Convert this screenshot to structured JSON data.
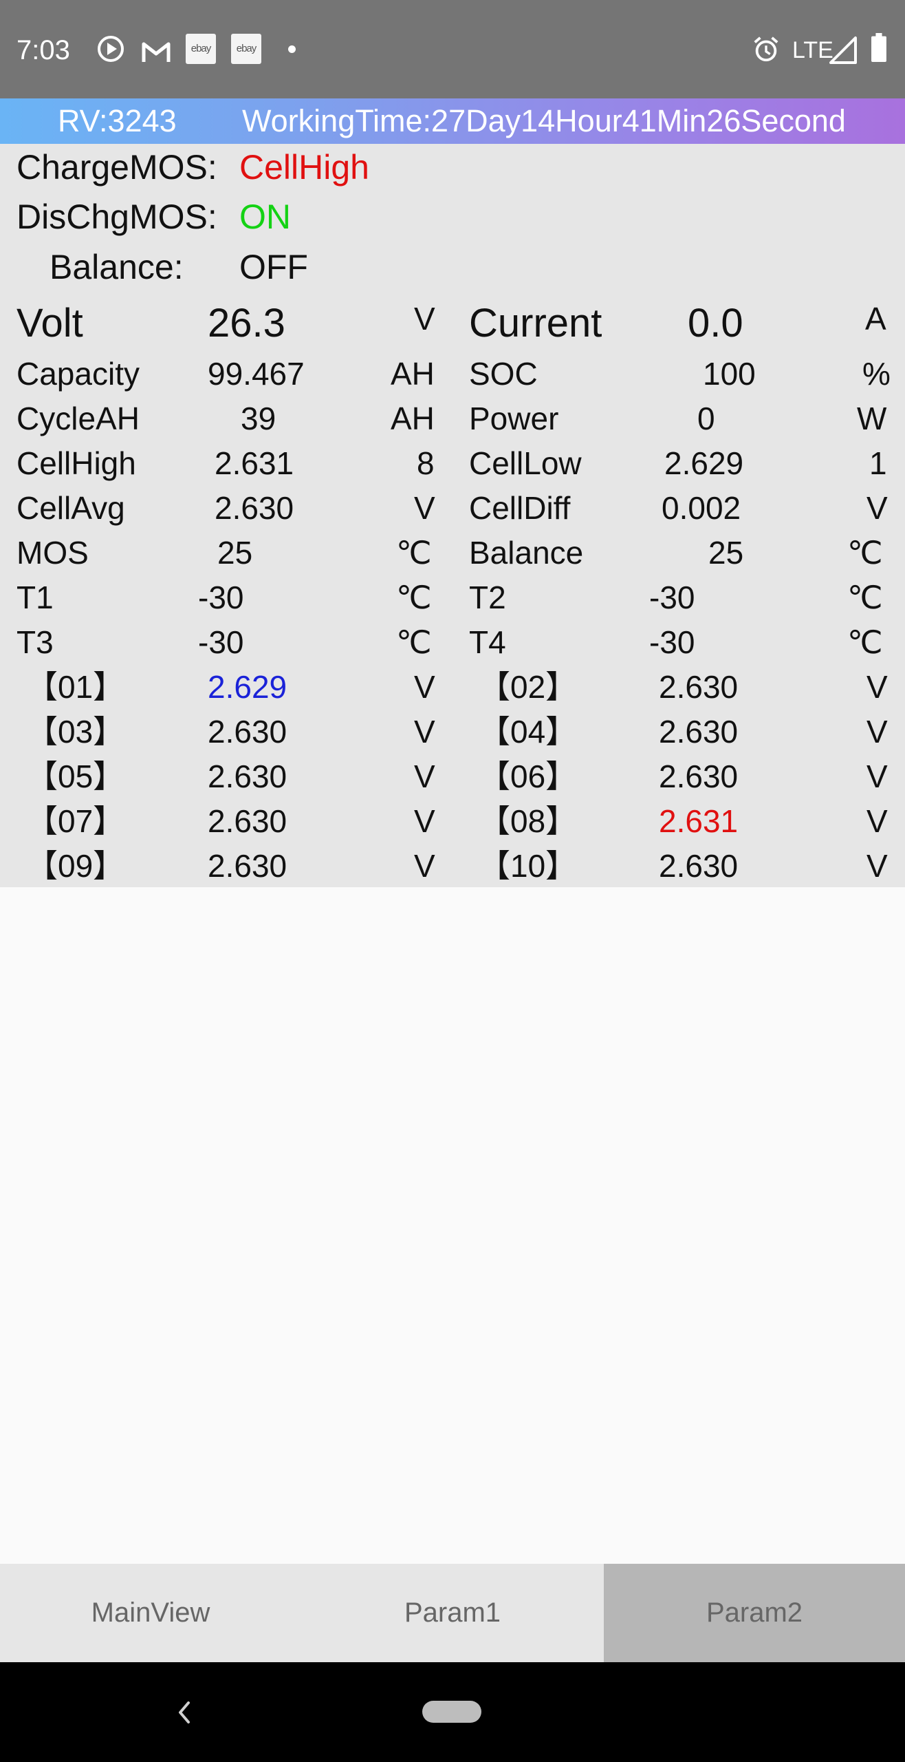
{
  "status_bar": {
    "time": "7:03",
    "icons": [
      "play-circle-icon",
      "gmail-icon",
      "ebay-icon",
      "ebay-icon",
      "dot-icon",
      "alarm-icon",
      "signal-icon",
      "battery-icon"
    ],
    "ebay_label": "ebay",
    "network": "LTE"
  },
  "header": {
    "rv": "RV:3243",
    "working_time": "WorkingTime:27Day14Hour41Min26Second",
    "gradient": [
      "#6ab4f5",
      "#a871de"
    ]
  },
  "state": {
    "charge_label": "ChargeMOS:",
    "charge_value": "CellHigh",
    "dischg_label": "DisChgMOS:",
    "dischg_value": "ON",
    "balance_label": "Balance:",
    "balance_value": "OFF"
  },
  "metrics_left": [
    {
      "label": "Volt",
      "value": "26.3",
      "unit": "V"
    },
    {
      "label": "Capacity",
      "value": "99.467",
      "unit": "AH"
    },
    {
      "label": "CycleAH",
      "value": "39",
      "unit": "AH"
    },
    {
      "label": "CellHigh",
      "value": "2.631",
      "unit": "8"
    },
    {
      "label": "CellAvg",
      "value": "2.630",
      "unit": "V"
    },
    {
      "label": "MOS",
      "value": "25",
      "unit": "℃"
    },
    {
      "label": "T1",
      "value": "-30",
      "unit": "℃"
    },
    {
      "label": "T3",
      "value": "-30",
      "unit": "℃"
    }
  ],
  "metrics_right": [
    {
      "label": "Current",
      "value": "0.0",
      "unit": "A"
    },
    {
      "label": "SOC",
      "value": "100",
      "unit": "%"
    },
    {
      "label": "Power",
      "value": "0",
      "unit": "W"
    },
    {
      "label": "CellLow",
      "value": "2.629",
      "unit": "1"
    },
    {
      "label": "CellDiff",
      "value": "0.002",
      "unit": "V"
    },
    {
      "label": "Balance",
      "value": "25",
      "unit": "℃"
    },
    {
      "label": "T2",
      "value": "-30",
      "unit": "℃"
    },
    {
      "label": "T4",
      "value": "-30",
      "unit": "℃"
    }
  ],
  "cells": [
    {
      "label": "【01】",
      "value": "2.629",
      "unit": "V"
    },
    {
      "label": "【02】",
      "value": "2.630",
      "unit": "V"
    },
    {
      "label": "【03】",
      "value": "2.630",
      "unit": "V"
    },
    {
      "label": "【04】",
      "value": "2.630",
      "unit": "V"
    },
    {
      "label": "【05】",
      "value": "2.630",
      "unit": "V"
    },
    {
      "label": "【06】",
      "value": "2.630",
      "unit": "V"
    },
    {
      "label": "【07】",
      "value": "2.630",
      "unit": "V"
    },
    {
      "label": "【08】",
      "value": "2.631",
      "unit": "V"
    },
    {
      "label": "【09】",
      "value": "2.630",
      "unit": "V"
    },
    {
      "label": "【10】",
      "value": "2.630",
      "unit": "V"
    }
  ],
  "colors": {
    "warning": "#e01010",
    "ok": "#14d214",
    "lowest_cell": "#1a22d8",
    "highest_cell": "#e01010"
  },
  "tabs": [
    {
      "label": "MainView"
    },
    {
      "label": "Param1"
    },
    {
      "label": "Param2",
      "active": true
    }
  ]
}
